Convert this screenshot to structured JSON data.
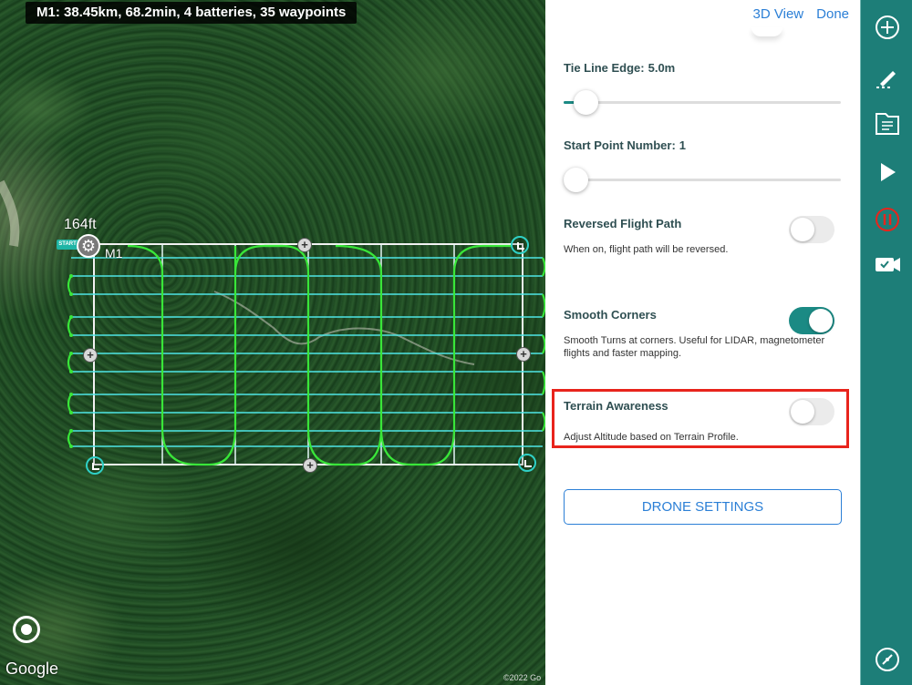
{
  "map": {
    "summary": "M1: 38.45km, 68.2min, 4 batteries, 35 waypoints",
    "altitude": "164ft",
    "mission_label": "M1",
    "start_badge": "START",
    "google_logo": "Google",
    "copyright": "©2022 Go"
  },
  "panel": {
    "view_3d": "3D View",
    "done": "Done",
    "tie_line_edge": {
      "label": "Tie Line Edge:",
      "value": "5.0m",
      "level": 0.04
    },
    "start_point": {
      "label": "Start Point Number:",
      "value": "1",
      "level": 0.0
    },
    "reversed_flight_path": {
      "label": "Reversed Flight Path",
      "description": "When on, flight path will be reversed.",
      "on": false
    },
    "smooth_corners": {
      "label": "Smooth Corners",
      "description": "Smooth Turns at corners. Useful for LIDAR, magnetometer flights and faster mapping.",
      "on": true
    },
    "terrain_awareness": {
      "label": "Terrain Awareness",
      "description": "Adjust Altitude based on Terrain Profile.",
      "on": false
    },
    "drone_settings": "DRONE SETTINGS"
  },
  "toolbar": {
    "icons": [
      "add-icon",
      "edit-waypoints-icon",
      "document-icon",
      "play-icon",
      "pause-icon",
      "camera-icon",
      "compass-icon"
    ],
    "pause_color": "#e8241c",
    "accent": "#1d7e78"
  }
}
